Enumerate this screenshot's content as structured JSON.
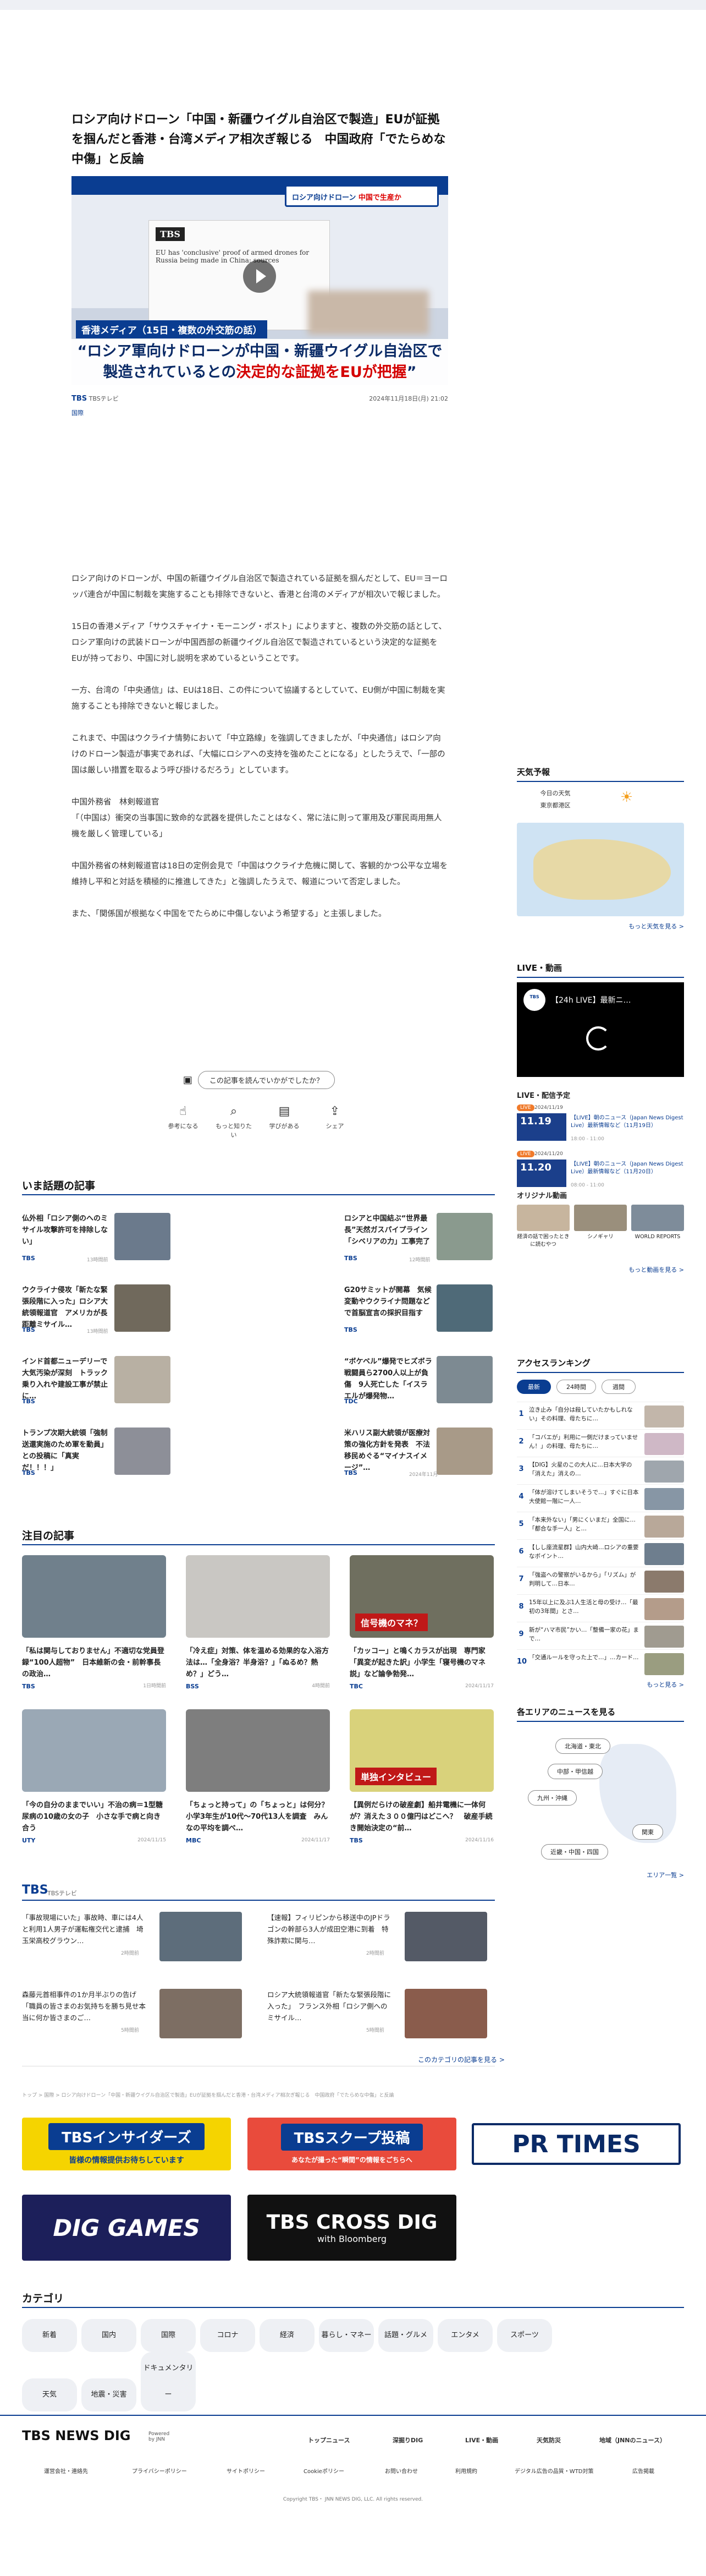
{
  "article": {
    "title": "ロシア向けドローン「中国・新疆ウイグル自治区で製造」EUが証拠を掴んだと香港・台湾メディア相次ぎ報じる　中国政府「でたらめな中傷」と反論",
    "hero": {
      "banner_text": "ロシア向けドローン",
      "banner_emph": "中国で生産か",
      "paper_badge": "TBS",
      "paper_headline": "EU has 'conclusive' proof of armed drones for Russia being made in China: sources",
      "tag": "香港メディア（15日・複数の外交筋の話）",
      "caption_line1": "“ロシア軍向けドローンが中国・新疆ウイグル自治区で",
      "caption_line2a": "製造されているとの",
      "caption_line2b": "決定的な証拠をEUが把握",
      "caption_line2c": "”"
    },
    "source": "TBSテレビ",
    "datetime": "2024年11月18日(月) 21:02",
    "category": "国際",
    "paragraphs": [
      "ロシア向けのドローンが、中国の新疆ウイグル自治区で製造されている証拠を掴んだとして、EU＝ヨーロッパ連合が中国に制裁を実施することも排除できないと、香港と台湾のメディアが相次いで報じました。",
      "15日の香港メディア「サウスチャイナ・モーニング・ポスト」によりますと、複数の外交筋の話として、ロシア軍向けの武装ドローンが中国西部の新疆ウイグル自治区で製造されているという決定的な証拠をEUが持っており、中国に対し説明を求めているということです。",
      "一方、台湾の「中央通信」は、EUは18日、この件について協議するとしていて、EU側が中国に制裁を実施することも排除できないと報じました。",
      "これまで、中国はウクライナ情勢において「中立路線」を強調してきましたが、「中央通信」はロシア向けのドローン製造が事実であれば、「大幅にロシアへの支持を強めたことになる」としたうえで、「一部の国は厳しい措置を取るよう呼び掛けるだろう」としています。",
      "中国外務省　林剣報道官\n「（中国は）衝突の当事国に致命的な武器を提供したことはなく、常に法に則って軍用及び軍民両用無人機を厳しく管理している」",
      "中国外務省の林剣報道官は18日の定例会見で「中国はウクライナ危機に関して、客観的かつ公平な立場を維持し平和と対話を積極的に推進してきた」と強調したうえで、報道について否定しました。",
      "また、「関係国が根拠なく中国をでたらめに中傷しないよう希望する」と主張しました。"
    ],
    "feedback": {
      "question": "この記事を読んでいかがでしたか？",
      "reactions": [
        "参考になる",
        "もっと知りたい",
        "学びがある",
        "シェア"
      ]
    }
  },
  "trending": {
    "heading": "いま話題の記事",
    "items": [
      {
        "title": "仏外相「ロシア側のへのミサイル攻撃許可を排除しない」",
        "source": "TBS",
        "time": "13時間前",
        "color": "#6b7a8c"
      },
      {
        "title": "ロシアと中国結ぶ“世界最長”天然ガスパイプライン「シベリアの力」工事完了",
        "source": "TBS",
        "time": "12時間前",
        "color": "#8a9a8e"
      },
      {
        "title": "ウクライナ侵攻「新たな緊張段階に入った」ロシア大統領報道官　アメリカが長距離ミサイル…",
        "source": "TBS",
        "time": "13時間前",
        "color": "#70695c"
      },
      {
        "title": "G20サミットが開幕　気候変動やウクライナ問題などで首脳宣言の採択目指す",
        "source": "TBS",
        "time": "",
        "color": "#4f6a78"
      },
      {
        "title": "インド首都ニューデリーで大気汚染が深刻　トラック乗り入れや建設工事が禁止に…",
        "source": "TBS",
        "time": "",
        "color": "#b8b0a3"
      },
      {
        "title": "“ボケベル”爆発でヒズボラ戦闘員ら2700人以上が負傷　9人死亡した「イスラエルが爆発物…",
        "source": "TDC",
        "time": "",
        "color": "#7d8a92"
      },
      {
        "title": "トランプ次期大統領「強制送還実施のため軍を動員」との投稿に「真実だ！！！」",
        "source": "TBS",
        "time": "",
        "color": "#8d8f98"
      },
      {
        "title": "米ハリス副大統領が医療対策の強化方針を発表　不法移民めぐる“マイナスイメージ”…",
        "source": "TBS",
        "time": "2024年11月",
        "color": "#a89a88"
      }
    ]
  },
  "featured": {
    "heading": "注目の記事",
    "items": [
      {
        "title": "「私は関与しておりません」不適切な党員登録“100人超物”　日本維新の会・前幹事長の政治…",
        "source": "TBS",
        "time": "1日時間前",
        "color": "#70808c",
        "overlay": ""
      },
      {
        "title": "「冷え症」対策、体を温める効果的な入浴方法は…「全身浴？半身浴？」「ぬるめ？熱め？」どう…",
        "source": "BSS",
        "time": "4時間前",
        "color": "#c9c7c3",
        "overlay": ""
      },
      {
        "title": "「カッコー」と鳴くカラスが出現　専門家「異変が起きた訳」小学生「寝号機のマネ説」など論争勃発…",
        "source": "TBC",
        "time": "2024/11/17",
        "color": "#6f6f5f",
        "overlay": "信号機のマネ？"
      },
      {
        "title": "「今の自分のままでいい」不治の病＝1型糖尿病の10歳の女の子　小さな手で病と向き合う",
        "source": "UTY",
        "time": "2024/11/15",
        "color": "#9aa8b5",
        "overlay": ""
      },
      {
        "title": "「ちょっと持って」の「ちょっと」は何分？小学3年生が10代〜70代13人を調査　みんなの平均を調べ…",
        "source": "MBC",
        "time": "2024/11/17",
        "color": "#7e7e7e",
        "overlay": ""
      },
      {
        "title": "【異例だらけの破産劇】船井電機に一体何が？消えた３００億円はどこへ？　破産手続き開始決定の“前…",
        "source": "TBS",
        "time": "2024/11/16",
        "color": "#d9d27b",
        "overlay": "単独インタビュー"
      }
    ]
  },
  "tbs": {
    "heading": "TBS",
    "sub": "TBSテレビ",
    "items": [
      {
        "title": "「事故現場にいた」事故時、車には4人と利用1人男子が運転権交代と逮捕　埼玉栄高校グラウン…",
        "time": "2時間前",
        "color": "#5d6d7b"
      },
      {
        "title": "【速報】フィリピンから移送中のJPドラゴンの幹部ら3人が成田空港に到着　特殊詐欺に関与…",
        "time": "2時間前",
        "color": "#545a66"
      },
      {
        "title": "森藤元首相事件の1か月半ぶりの告げ「職員の皆さまのお気持ちを勝ち見せ本当に何か皆さまのご…",
        "time": "5時間前",
        "color": "#7d6e63"
      },
      {
        "title": "ロシア大統領報道官「新たな緊張段階に入った」　フランス外相「ロシア側へのミサイル…",
        "time": "5時間前",
        "color": "#8a5c4c"
      }
    ],
    "more": "このカテゴリの記事を見る >"
  },
  "breadcrumb": "トップ > 国際 > ロシア向けドローン「中国・新疆ウイグル自治区で製造」EUが証拠を掴んだと香港・台湾メディア相次ぎ報じる　中国政府「でたらめな中傷」と反論",
  "banners": {
    "insiders": "TBSインサイダーズ",
    "insiders_sub": "皆様の情報提供お待ちしています",
    "scoop": "TBSスクープ投稿",
    "scoop_sub": "あなたが撮った“瞬間”の情報をごちらへ",
    "prtimes": "PR TIMES",
    "diggames": "DIG GAMES",
    "crossdig": "TBS CROSS DIG",
    "crossdig_sub": "with Bloomberg"
  },
  "categories": {
    "heading": "カテゴリ",
    "items": [
      "新着",
      "国内",
      "国際",
      "コロナ",
      "経済",
      "暮らし・マネー",
      "話題・グルメ",
      "エンタメ",
      "スポーツ",
      "天気",
      "地震・災害",
      "ドキュメンタリー"
    ]
  },
  "footer": {
    "logo": "TBS NEWS DIG",
    "logo_sub": "Powered by JNN",
    "nav": [
      "トップニュース",
      "深掘りDIG",
      "LIVE・動画",
      "天気防災",
      "地域（JNNのニュース）"
    ],
    "links": [
      "運営会社・連絡先",
      "プライバシーポリシー",
      "サイトポリシー",
      "Cookieポリシー",
      "お問い合わせ",
      "利用規約",
      "デジタル広告の品質・WTD対策",
      "広告掲載"
    ],
    "copyright": "Copyright TBS・ JNN NEWS DIG, LLC. All rights reserved."
  },
  "sidebar": {
    "weather": {
      "heading": "天気予報",
      "today": "今日の天気",
      "region": "東京都港区",
      "more": "もっと天気を見る >"
    },
    "live": {
      "heading": "LIVE・動画",
      "title": "【24h LIVE】最新ニ…"
    },
    "schedule": {
      "heading": "LIVE・配信予定",
      "items": [
        {
          "badge": "LIVE",
          "date": "2024/11/19",
          "time_big": "11.19",
          "title": "【LIVE】朝のニュース（Japan News Digest Live）最新情報など（11月19日）",
          "slot": "18:00 - 11:00"
        },
        {
          "badge": "LIVE",
          "date": "2024/11/20",
          "time_big": "11.20",
          "title": "【LIVE】朝のニュース（Japan News Digest Live）最新情報など（11月20日）",
          "slot": "08:00 - 11:00"
        }
      ]
    },
    "original": {
      "heading": "オリジナル動画",
      "items": [
        {
          "title": "経済の話で困ったときに読むやつ",
          "color": "#c7b59e"
        },
        {
          "title": "シノギャリ",
          "color": "#9a8f7c"
        },
        {
          "title": "WORLD REPORTS",
          "color": "#7e8c9a"
        }
      ],
      "more": "もっと動画を見る >"
    },
    "ranking": {
      "heading": "アクセスランキング",
      "tabs": [
        "最新",
        "24時間",
        "週間"
      ],
      "items": [
        {
          "title": "泣き止み「自分は殺していたかもしれない」その料理、母たちに…",
          "color": "#c2b6aa"
        },
        {
          "title": "「コバエが」利用に一側だけまっていません！」の料理、母たちに…",
          "color": "#cfb8c6"
        },
        {
          "title": "【DIG】火星のこの大人に…日本大学の「消えた」消えの…",
          "color": "#9fa6ad"
        },
        {
          "title": "「体が溶けてしまいそうで…」すぐに日本大使館一階に一人…",
          "color": "#8796a5"
        },
        {
          "title": "「本来外ない」「男にくいまだ」全国に…「都合な手一人」と…",
          "color": "#b8a899"
        },
        {
          "title": "【しし座流星群】山内大崎…ロシアの重要なボイント…",
          "color": "#6e7e8e"
        },
        {
          "title": "「強盗への警察がいるから」「リズム」が判明して…日本…",
          "color": "#8b7a6c"
        },
        {
          "title": "15年以上に及ぶ1人生活と母の受け…「最初の3年間」とさ…",
          "color": "#b49c8a"
        },
        {
          "title": "新が“ハマ市民”かい…「整備一家の花」まで…",
          "color": "#a09b90"
        },
        {
          "title": "「交通ルールを守った上で…」…カード…",
          "color": "#9a9d80"
        }
      ],
      "more": "もっと見る >"
    },
    "area": {
      "heading": "各エリアのニュースを見る",
      "regions": [
        "北海道・東北",
        "中部・甲信越",
        "九州・沖縄",
        "関東",
        "近畿・中国・四国"
      ],
      "more": "エリア一覧 >"
    }
  }
}
